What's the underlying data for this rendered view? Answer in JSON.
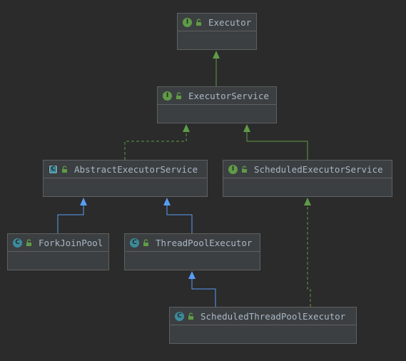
{
  "colors": {
    "background": "#2b2b2b",
    "node_fill": "#3c3f41",
    "node_border": "#5e6060",
    "text": "#a9b7c6",
    "interface_icon": "#5f9b47",
    "class_icon": "#3b8b9b",
    "interface_edge": "#5f9b47",
    "class_edge": "#589df6"
  },
  "nodes": {
    "executor": {
      "label": "Executor",
      "kind": "I"
    },
    "executor_service": {
      "label": "ExecutorService",
      "kind": "I"
    },
    "abstract_executor_service": {
      "label": "AbstractExecutorService",
      "kind": "C"
    },
    "scheduled_executor_service": {
      "label": "ScheduledExecutorService",
      "kind": "I"
    },
    "fork_join_pool": {
      "label": "ForkJoinPool",
      "kind": "C"
    },
    "thread_pool_executor": {
      "label": "ThreadPoolExecutor",
      "kind": "C"
    },
    "scheduled_thread_pool_executor": {
      "label": "ScheduledThreadPoolExecutor",
      "kind": "C"
    }
  },
  "edges": [
    {
      "from": "executor_service",
      "to": "executor",
      "type": "extends-interface",
      "style": "solid"
    },
    {
      "from": "abstract_executor_service",
      "to": "executor_service",
      "type": "implements",
      "style": "dashed"
    },
    {
      "from": "scheduled_executor_service",
      "to": "executor_service",
      "type": "extends-interface",
      "style": "solid"
    },
    {
      "from": "fork_join_pool",
      "to": "abstract_executor_service",
      "type": "extends-class",
      "style": "solid"
    },
    {
      "from": "thread_pool_executor",
      "to": "abstract_executor_service",
      "type": "extends-class",
      "style": "solid"
    },
    {
      "from": "scheduled_thread_pool_executor",
      "to": "thread_pool_executor",
      "type": "extends-class",
      "style": "solid"
    },
    {
      "from": "scheduled_thread_pool_executor",
      "to": "scheduled_executor_service",
      "type": "implements",
      "style": "dashed"
    }
  ]
}
